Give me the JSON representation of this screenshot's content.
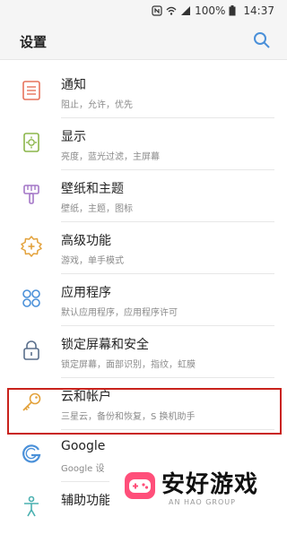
{
  "status": {
    "battery": "100%",
    "time": "14:37",
    "icons": [
      "nfc-icon",
      "wifi-icon",
      "signal-icon",
      "battery-icon"
    ]
  },
  "header": {
    "title": "设置",
    "search_icon": "search-icon",
    "accent": "#4a90d9"
  },
  "settings": [
    {
      "title": "通知",
      "subtitle": "阻止，允许，优先",
      "icon": "notification-icon",
      "color": "#e6735c"
    },
    {
      "title": "显示",
      "subtitle": "亮度，蓝光过滤，主屏幕",
      "icon": "display-icon",
      "color": "#8bb64a"
    },
    {
      "title": "壁纸和主题",
      "subtitle": "壁纸，主题，图标",
      "icon": "theme-brush-icon",
      "color": "#a477c7"
    },
    {
      "title": "高级功能",
      "subtitle": "游戏，单手模式",
      "icon": "gear-plus-icon",
      "color": "#e3a23c"
    },
    {
      "title": "应用程序",
      "subtitle": "默认应用程序，应用程序许可",
      "icon": "apps-icon",
      "color": "#4a90d9"
    },
    {
      "title": "锁定屏幕和安全",
      "subtitle": "锁定屏幕，面部识别，指纹，虹膜",
      "icon": "lock-icon",
      "color": "#5a6f8c"
    },
    {
      "title": "云和帐户",
      "subtitle": "三星云，备份和恢复，S 换机助手",
      "icon": "key-icon",
      "color": "#e3a23c"
    },
    {
      "title": "Google",
      "subtitle": "Google 设",
      "icon": "google-icon",
      "color": "#4a90d9"
    },
    {
      "title": "辅助功能",
      "subtitle": "",
      "icon": "accessibility-icon",
      "color": "#4ab0b0"
    }
  ],
  "watermark": {
    "brand": "安好游戏",
    "sub": "AN HAO GROUP",
    "colors": {
      "pink": "#ff4f7a",
      "white": "#ffffff"
    }
  },
  "highlight_color": "#c9221c"
}
